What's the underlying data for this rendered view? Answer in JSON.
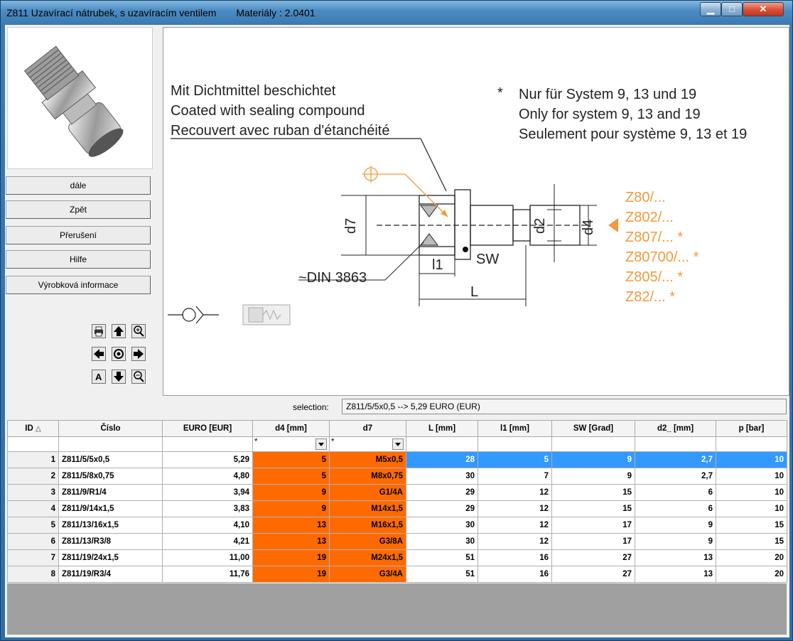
{
  "window": {
    "title": "Z811 Uzavírací nátrubek, s uzavíracím ventilem",
    "material": "Materiály : 2.0401"
  },
  "sidebar": {
    "buttons": [
      "dále",
      "Zpět",
      "Přerušení",
      "Hilfe",
      "Výrobková informace"
    ]
  },
  "toolbar_icons": [
    "print-icon",
    "arrow-up-icon",
    "zoom-in-icon",
    "arrow-left-icon",
    "center-icon",
    "arrow-right-icon",
    "text-icon",
    "arrow-down-icon",
    "zoom-out-icon"
  ],
  "drawing": {
    "note_de": "Mit Dichtmittel beschichtet",
    "note_en": "Coated with sealing compound",
    "note_fr": "Recouvert avec ruban d'étanchéité",
    "star": "*",
    "system_de": "Nur für System 9, 13 und 19",
    "system_en": "Only for system 9, 13 and 19",
    "system_fr": "Seulement pour système 9, 13 et 19",
    "din": "~DIN 3863",
    "d7": "d7",
    "d2": "d2",
    "d4": "d4",
    "sw": "SW",
    "l1": "l1",
    "L": "L",
    "refs": [
      "Z80/...",
      "Z802/...",
      "Z807/... *",
      "Z80700/... *",
      "Z805/... *",
      "Z82/... *"
    ],
    "accent": "#f39a3c"
  },
  "selection": {
    "label": "selection:",
    "value": "Z811/5/5x0,5 --> 5,29 EURO (EUR)"
  },
  "table": {
    "headers": [
      "ID",
      "Číslo",
      "EURO [EUR]",
      "d4 [mm]",
      "d7",
      "L [mm]",
      "l1 [mm]",
      "SW [Grad]",
      "d2_ [mm]",
      "p [bar]"
    ],
    "filter_d4": "*",
    "filter_d7": "*",
    "rows": [
      [
        "1",
        "Z811/5/5x0,5",
        "5,29",
        "5",
        "M5x0,5",
        "28",
        "5",
        "9",
        "2,7",
        "10"
      ],
      [
        "2",
        "Z811/5/8x0,75",
        "4,80",
        "5",
        "M8x0,75",
        "30",
        "7",
        "9",
        "2,7",
        "10"
      ],
      [
        "3",
        "Z811/9/R1/4",
        "3,94",
        "9",
        "G1/4A",
        "29",
        "12",
        "15",
        "6",
        "10"
      ],
      [
        "4",
        "Z811/9/14x1,5",
        "3,83",
        "9",
        "M14x1,5",
        "29",
        "12",
        "15",
        "6",
        "10"
      ],
      [
        "5",
        "Z811/13/16x1,5",
        "4,10",
        "13",
        "M16x1,5",
        "30",
        "12",
        "17",
        "9",
        "15"
      ],
      [
        "6",
        "Z811/13/R3/8",
        "4,21",
        "13",
        "G3/8A",
        "30",
        "12",
        "17",
        "9",
        "15"
      ],
      [
        "7",
        "Z811/19/24x1,5",
        "11,00",
        "19",
        "M24x1,5",
        "51",
        "16",
        "27",
        "13",
        "20"
      ],
      [
        "8",
        "Z811/19/R3/4",
        "11,76",
        "19",
        "G3/4A",
        "51",
        "16",
        "27",
        "13",
        "20"
      ]
    ],
    "highlight_color": "#ff6a00",
    "selected_color": "#3399ff"
  }
}
